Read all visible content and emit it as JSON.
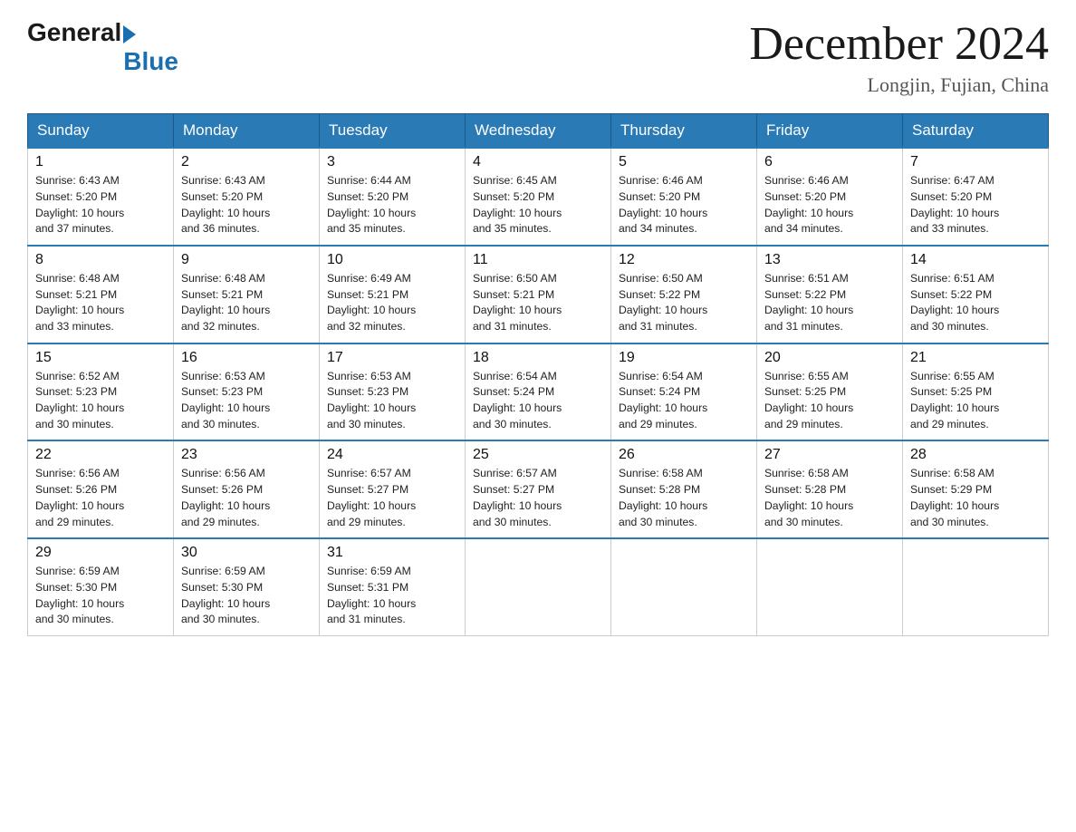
{
  "logo": {
    "general": "General",
    "blue": "Blue"
  },
  "title": "December 2024",
  "location": "Longjin, Fujian, China",
  "days_of_week": [
    "Sunday",
    "Monday",
    "Tuesday",
    "Wednesday",
    "Thursday",
    "Friday",
    "Saturday"
  ],
  "weeks": [
    [
      {
        "day": "1",
        "info": "Sunrise: 6:43 AM\nSunset: 5:20 PM\nDaylight: 10 hours\nand 37 minutes."
      },
      {
        "day": "2",
        "info": "Sunrise: 6:43 AM\nSunset: 5:20 PM\nDaylight: 10 hours\nand 36 minutes."
      },
      {
        "day": "3",
        "info": "Sunrise: 6:44 AM\nSunset: 5:20 PM\nDaylight: 10 hours\nand 35 minutes."
      },
      {
        "day": "4",
        "info": "Sunrise: 6:45 AM\nSunset: 5:20 PM\nDaylight: 10 hours\nand 35 minutes."
      },
      {
        "day": "5",
        "info": "Sunrise: 6:46 AM\nSunset: 5:20 PM\nDaylight: 10 hours\nand 34 minutes."
      },
      {
        "day": "6",
        "info": "Sunrise: 6:46 AM\nSunset: 5:20 PM\nDaylight: 10 hours\nand 34 minutes."
      },
      {
        "day": "7",
        "info": "Sunrise: 6:47 AM\nSunset: 5:20 PM\nDaylight: 10 hours\nand 33 minutes."
      }
    ],
    [
      {
        "day": "8",
        "info": "Sunrise: 6:48 AM\nSunset: 5:21 PM\nDaylight: 10 hours\nand 33 minutes."
      },
      {
        "day": "9",
        "info": "Sunrise: 6:48 AM\nSunset: 5:21 PM\nDaylight: 10 hours\nand 32 minutes."
      },
      {
        "day": "10",
        "info": "Sunrise: 6:49 AM\nSunset: 5:21 PM\nDaylight: 10 hours\nand 32 minutes."
      },
      {
        "day": "11",
        "info": "Sunrise: 6:50 AM\nSunset: 5:21 PM\nDaylight: 10 hours\nand 31 minutes."
      },
      {
        "day": "12",
        "info": "Sunrise: 6:50 AM\nSunset: 5:22 PM\nDaylight: 10 hours\nand 31 minutes."
      },
      {
        "day": "13",
        "info": "Sunrise: 6:51 AM\nSunset: 5:22 PM\nDaylight: 10 hours\nand 31 minutes."
      },
      {
        "day": "14",
        "info": "Sunrise: 6:51 AM\nSunset: 5:22 PM\nDaylight: 10 hours\nand 30 minutes."
      }
    ],
    [
      {
        "day": "15",
        "info": "Sunrise: 6:52 AM\nSunset: 5:23 PM\nDaylight: 10 hours\nand 30 minutes."
      },
      {
        "day": "16",
        "info": "Sunrise: 6:53 AM\nSunset: 5:23 PM\nDaylight: 10 hours\nand 30 minutes."
      },
      {
        "day": "17",
        "info": "Sunrise: 6:53 AM\nSunset: 5:23 PM\nDaylight: 10 hours\nand 30 minutes."
      },
      {
        "day": "18",
        "info": "Sunrise: 6:54 AM\nSunset: 5:24 PM\nDaylight: 10 hours\nand 30 minutes."
      },
      {
        "day": "19",
        "info": "Sunrise: 6:54 AM\nSunset: 5:24 PM\nDaylight: 10 hours\nand 29 minutes."
      },
      {
        "day": "20",
        "info": "Sunrise: 6:55 AM\nSunset: 5:25 PM\nDaylight: 10 hours\nand 29 minutes."
      },
      {
        "day": "21",
        "info": "Sunrise: 6:55 AM\nSunset: 5:25 PM\nDaylight: 10 hours\nand 29 minutes."
      }
    ],
    [
      {
        "day": "22",
        "info": "Sunrise: 6:56 AM\nSunset: 5:26 PM\nDaylight: 10 hours\nand 29 minutes."
      },
      {
        "day": "23",
        "info": "Sunrise: 6:56 AM\nSunset: 5:26 PM\nDaylight: 10 hours\nand 29 minutes."
      },
      {
        "day": "24",
        "info": "Sunrise: 6:57 AM\nSunset: 5:27 PM\nDaylight: 10 hours\nand 29 minutes."
      },
      {
        "day": "25",
        "info": "Sunrise: 6:57 AM\nSunset: 5:27 PM\nDaylight: 10 hours\nand 30 minutes."
      },
      {
        "day": "26",
        "info": "Sunrise: 6:58 AM\nSunset: 5:28 PM\nDaylight: 10 hours\nand 30 minutes."
      },
      {
        "day": "27",
        "info": "Sunrise: 6:58 AM\nSunset: 5:28 PM\nDaylight: 10 hours\nand 30 minutes."
      },
      {
        "day": "28",
        "info": "Sunrise: 6:58 AM\nSunset: 5:29 PM\nDaylight: 10 hours\nand 30 minutes."
      }
    ],
    [
      {
        "day": "29",
        "info": "Sunrise: 6:59 AM\nSunset: 5:30 PM\nDaylight: 10 hours\nand 30 minutes."
      },
      {
        "day": "30",
        "info": "Sunrise: 6:59 AM\nSunset: 5:30 PM\nDaylight: 10 hours\nand 30 minutes."
      },
      {
        "day": "31",
        "info": "Sunrise: 6:59 AM\nSunset: 5:31 PM\nDaylight: 10 hours\nand 31 minutes."
      },
      null,
      null,
      null,
      null
    ]
  ]
}
